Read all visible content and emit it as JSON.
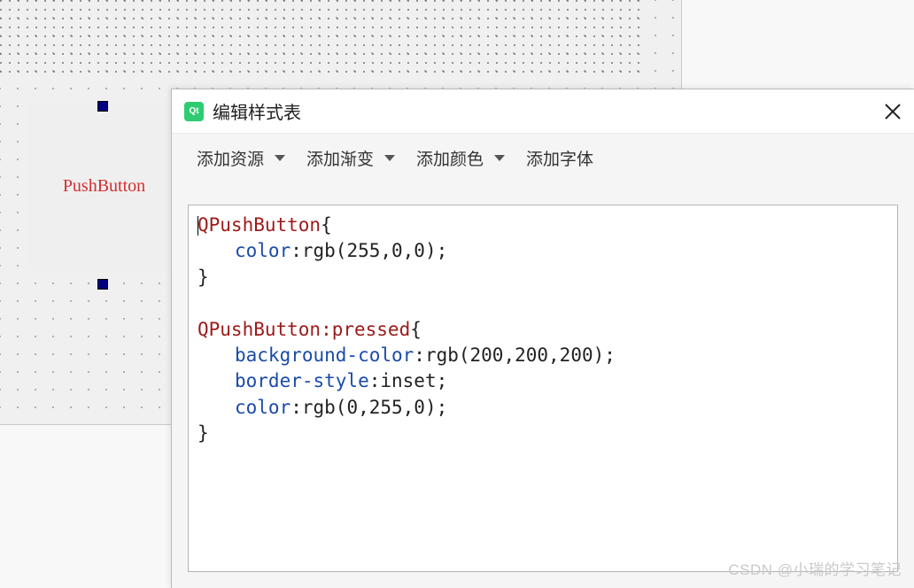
{
  "designer": {
    "pushbutton_label": "PushButton"
  },
  "dialog": {
    "title": "编辑样式表",
    "qt_icon_text": "Qt",
    "toolbar": {
      "add_resource": "添加资源",
      "add_gradient": "添加渐变",
      "add_color": "添加颜色",
      "add_font": "添加字体"
    }
  },
  "code": {
    "block1": {
      "selector": "QPushButton",
      "open": "{",
      "l1_prop": "color",
      "l1_colon": ":",
      "l1_val": "rgb(255,0,0);",
      "close": "}"
    },
    "block2": {
      "selector": "QPushButton:pressed",
      "open": "{",
      "l1_prop": "background-color",
      "l1_colon": ":",
      "l1_val": "rgb(200,200,200);",
      "l2_prop": "border-style",
      "l2_colon": ":",
      "l2_val": "inset;",
      "l3_prop": "color",
      "l3_colon": ":",
      "l3_val": "rgb(0,255,0);",
      "close": "}"
    }
  },
  "watermark": "CSDN @小瑞的学习笔记"
}
